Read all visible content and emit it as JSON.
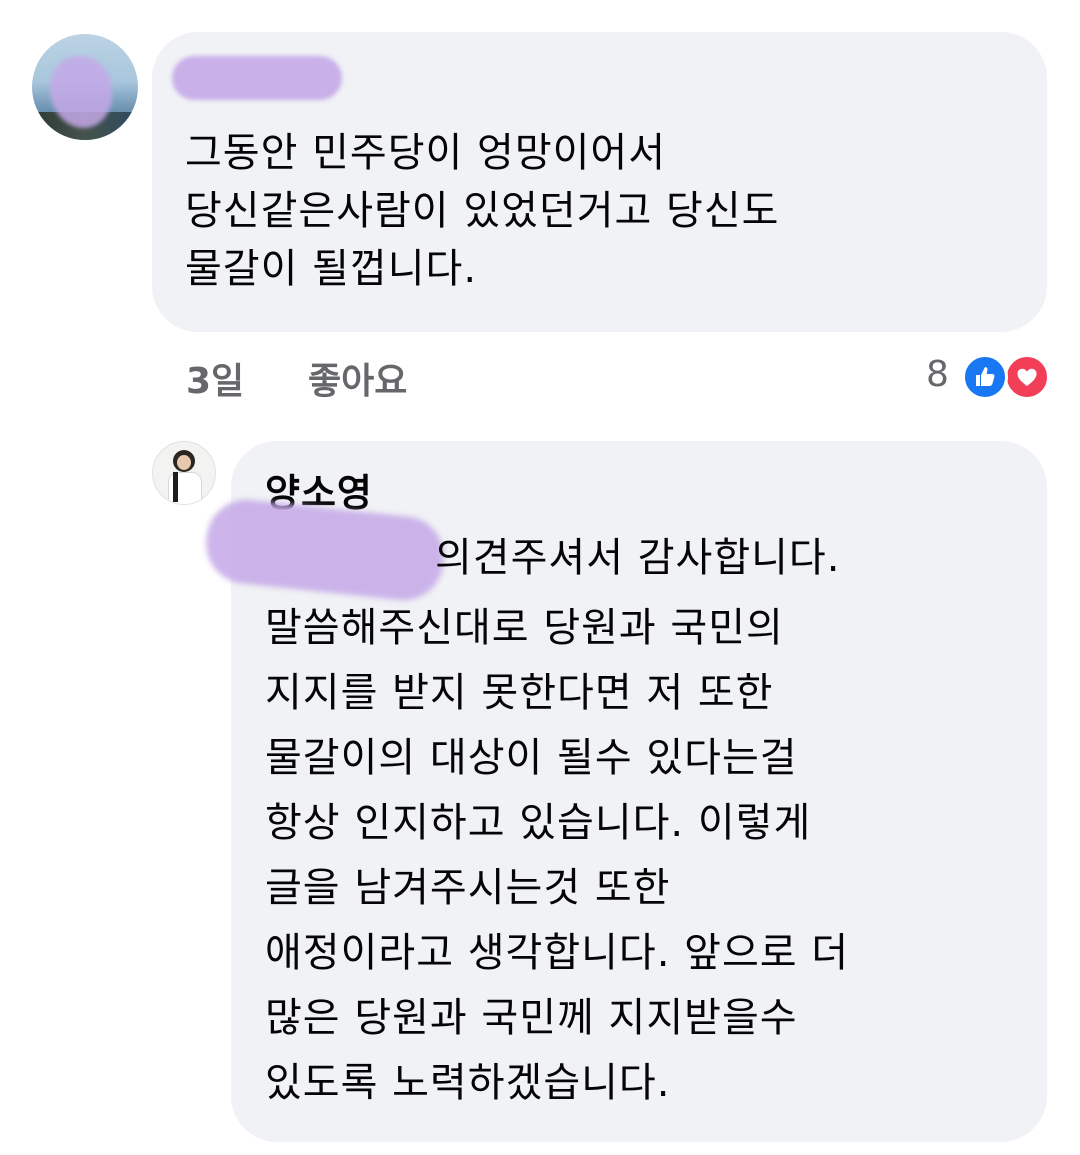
{
  "comment": {
    "text": "그동안 민주당이 엉망이어서\n당신같은사람이 있었던거고 당신도\n물갈이 될껍니다.",
    "time": "3일",
    "like_label": "좋아요",
    "reaction_count": "8",
    "reactions": [
      "like-icon",
      "love-icon"
    ],
    "colors": {
      "like": "#1877f2",
      "love": "#f33e58",
      "bubble": "#f0f2f5",
      "meta": "#65676b"
    }
  },
  "reply": {
    "author": "양소영",
    "first_line": "의견주셔서 감사합니다.",
    "rest_text": "말씀해주신대로 당원과 국민의\n지지를 받지 못한다면 저 또한\n물갈이의 대상이 될수 있다는걸\n항상 인지하고 있습니다. 이렇게\n글을 남겨주시는것 또한\n애정이라고 생각합니다. 앞으로 더\n많은 당원과 국민께 지지받을수\n있도록 노력하겠습니다."
  }
}
